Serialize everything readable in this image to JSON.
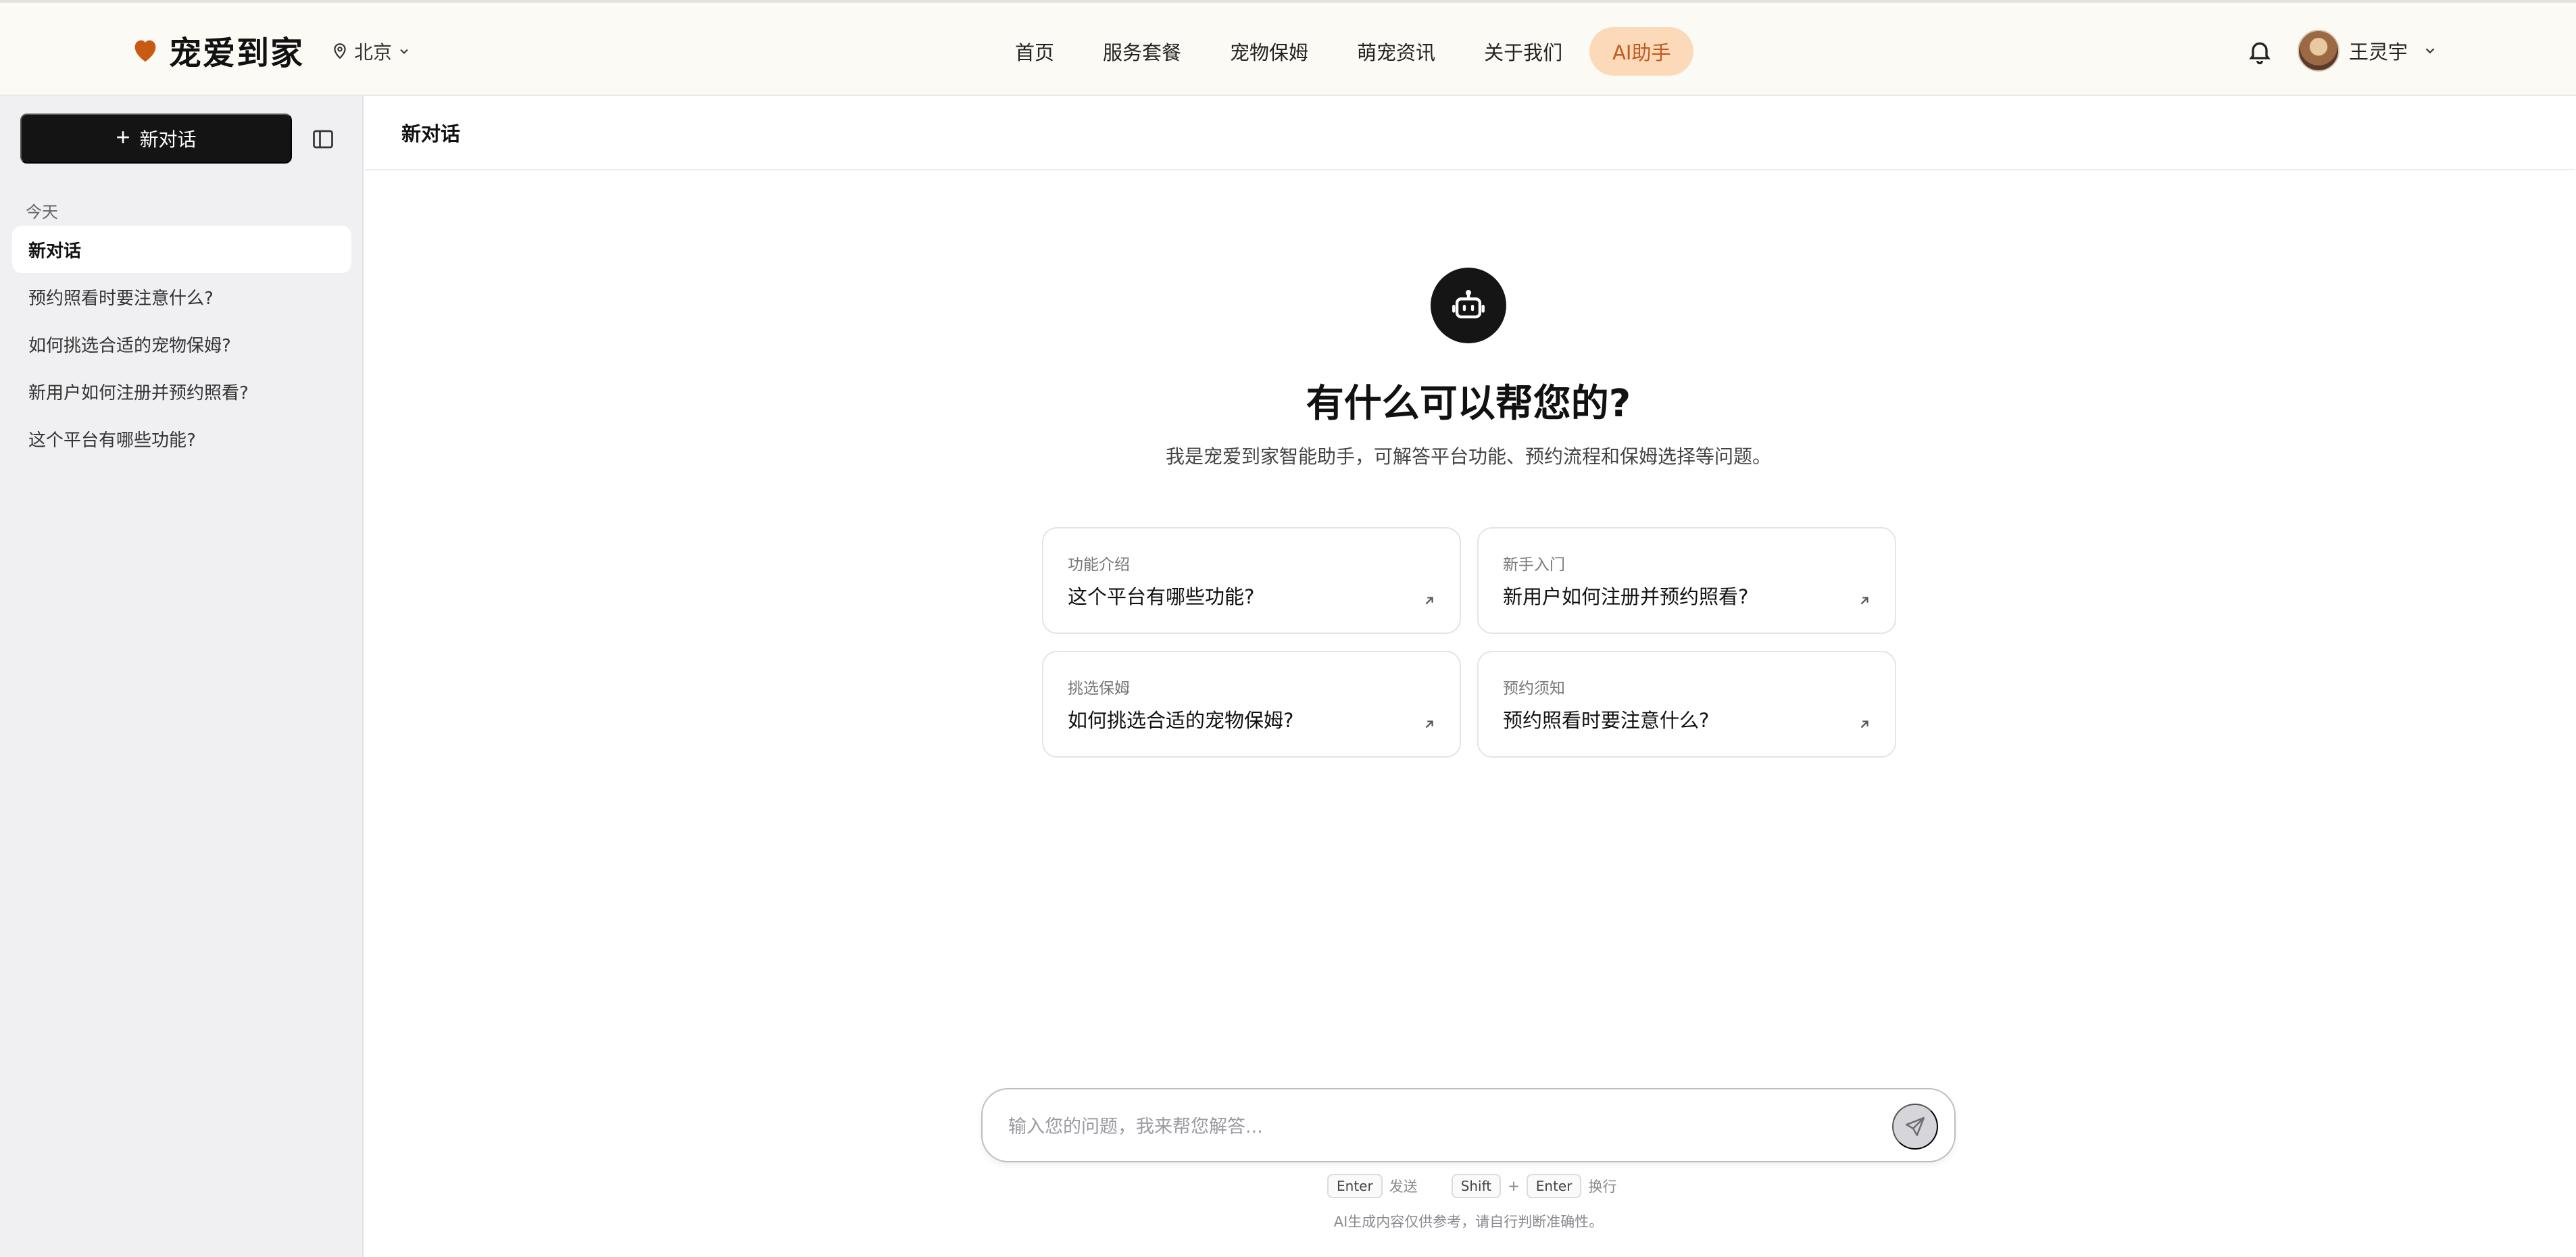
{
  "brand": {
    "name": "宠爱到家",
    "accent": "#c85a14"
  },
  "header": {
    "city": "北京",
    "nav": [
      "首页",
      "服务套餐",
      "宠物保姆",
      "萌宠资讯",
      "关于我们",
      "AI助手"
    ],
    "active_nav": "AI助手",
    "user_name": "王灵宇"
  },
  "sidebar": {
    "new_chat_label": "新对话",
    "section_label": "今天",
    "conversations": [
      "新对话",
      "预约照看时要注意什么?",
      "如何挑选合适的宠物保姆?",
      "新用户如何注册并预约照看?",
      "这个平台有哪些功能?"
    ]
  },
  "main": {
    "title": "新对话",
    "hero_title": "有什么可以帮您的?",
    "hero_subtitle": "我是宠爱到家智能助手，可解答平台功能、预约流程和保姆选择等问题。",
    "suggestions": [
      {
        "tag": "功能介绍",
        "question": "这个平台有哪些功能?"
      },
      {
        "tag": "新手入门",
        "question": "新用户如何注册并预约照看?"
      },
      {
        "tag": "挑选保姆",
        "question": "如何挑选合适的宠物保姆?"
      },
      {
        "tag": "预约须知",
        "question": "预约照看时要注意什么?"
      }
    ]
  },
  "composer": {
    "placeholder": "输入您的问题，我来帮您解答...",
    "hint_enter_key": "Enter",
    "hint_send": "发送",
    "hint_shift_key": "Shift",
    "hint_plus": "+",
    "hint_enter_key2": "Enter",
    "hint_newline": "换行",
    "disclaimer": "AI生成内容仅供参考，请自行判断准确性。"
  },
  "icons": {
    "logo": "heart-icon",
    "city": "location-pin-icon",
    "city_caret": "chevron-down-icon",
    "notifications": "bell-icon",
    "user_caret": "chevron-down-icon",
    "sidebar_toggle": "sidebar-panel-icon",
    "assistant": "robot-icon",
    "card_arrow": "arrow-up-right-icon",
    "send": "send-icon"
  }
}
